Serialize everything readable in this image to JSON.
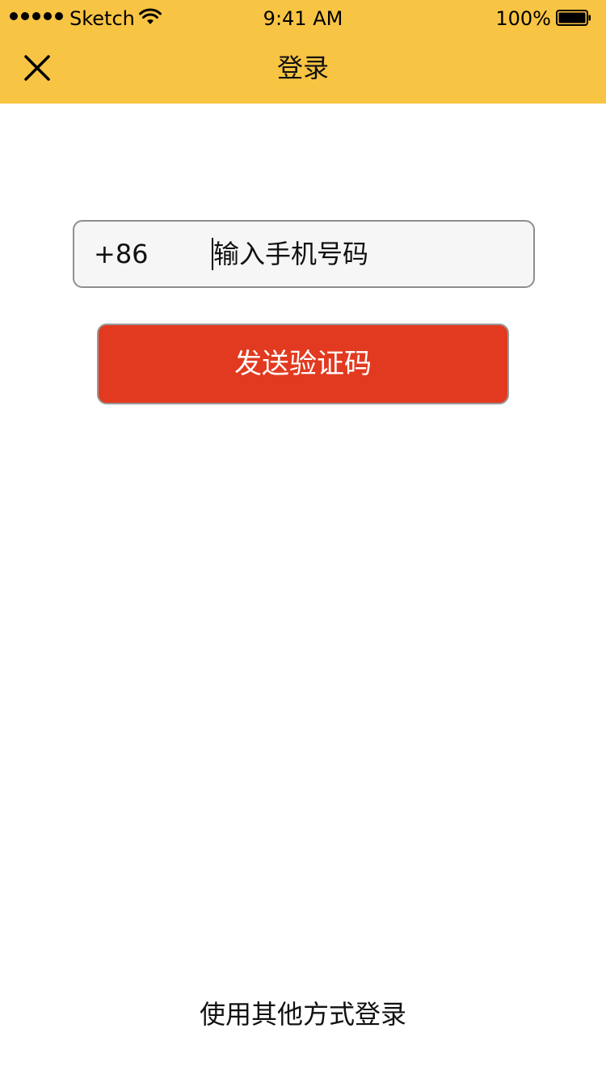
{
  "status_bar": {
    "carrier": "Sketch",
    "time": "9:41 AM",
    "battery": "100%",
    "icons": [
      "signal-dots-icon",
      "wifi-icon",
      "battery-icon"
    ]
  },
  "nav": {
    "title": "登录",
    "close_icon": "close-icon"
  },
  "form": {
    "country_code": "+86",
    "phone_placeholder": "输入手机号码",
    "phone_value": "",
    "send_button_label": "发送验证码"
  },
  "footer": {
    "other_login_label": "使用其他方式登录"
  },
  "colors": {
    "header_bg": "#F8C443",
    "button_bg": "#E23A20",
    "field_bg": "#F6F6F6"
  }
}
